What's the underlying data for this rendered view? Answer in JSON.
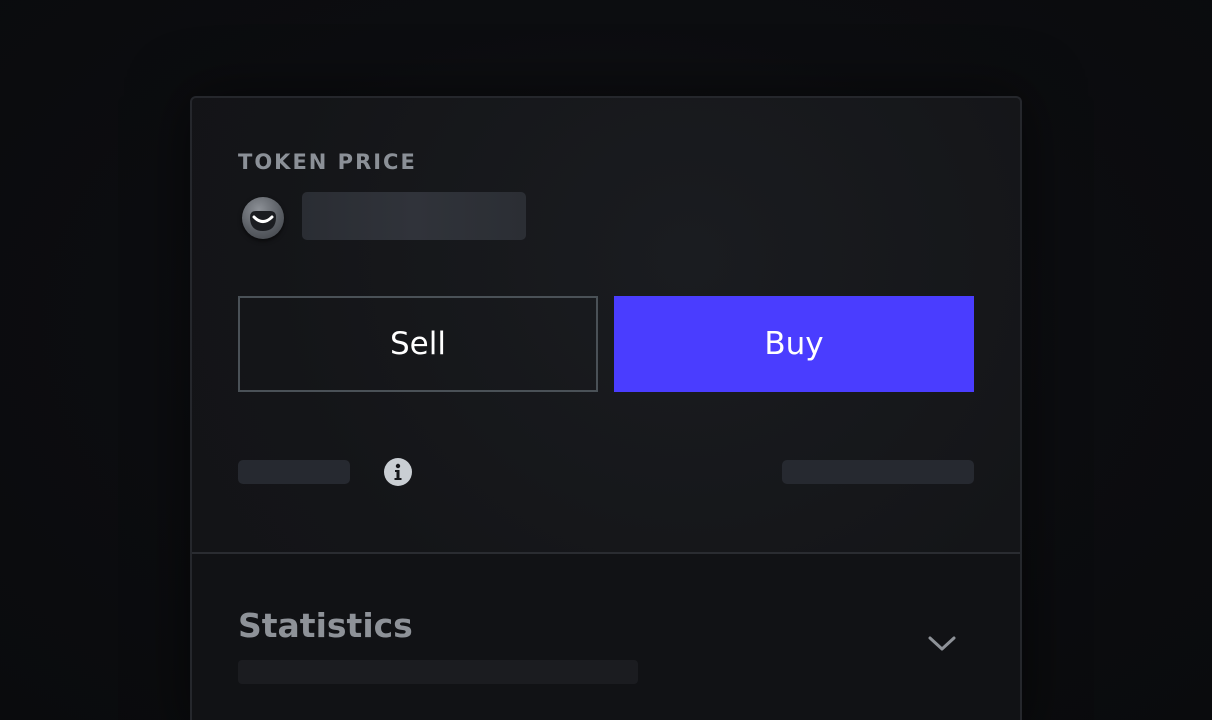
{
  "token": {
    "price_label": "TOKEN PRICE",
    "icon": "token-face-icon"
  },
  "actions": {
    "sell_label": "Sell",
    "buy_label": "Buy"
  },
  "details": {
    "info_icon": "info-icon"
  },
  "statistics": {
    "title": "Statistics",
    "toggle_icon": "chevron-down-icon"
  },
  "colors": {
    "accent": "#4a3dff",
    "background": "#0b0c0f",
    "card": "#141518",
    "muted_text": "#8b9097"
  }
}
